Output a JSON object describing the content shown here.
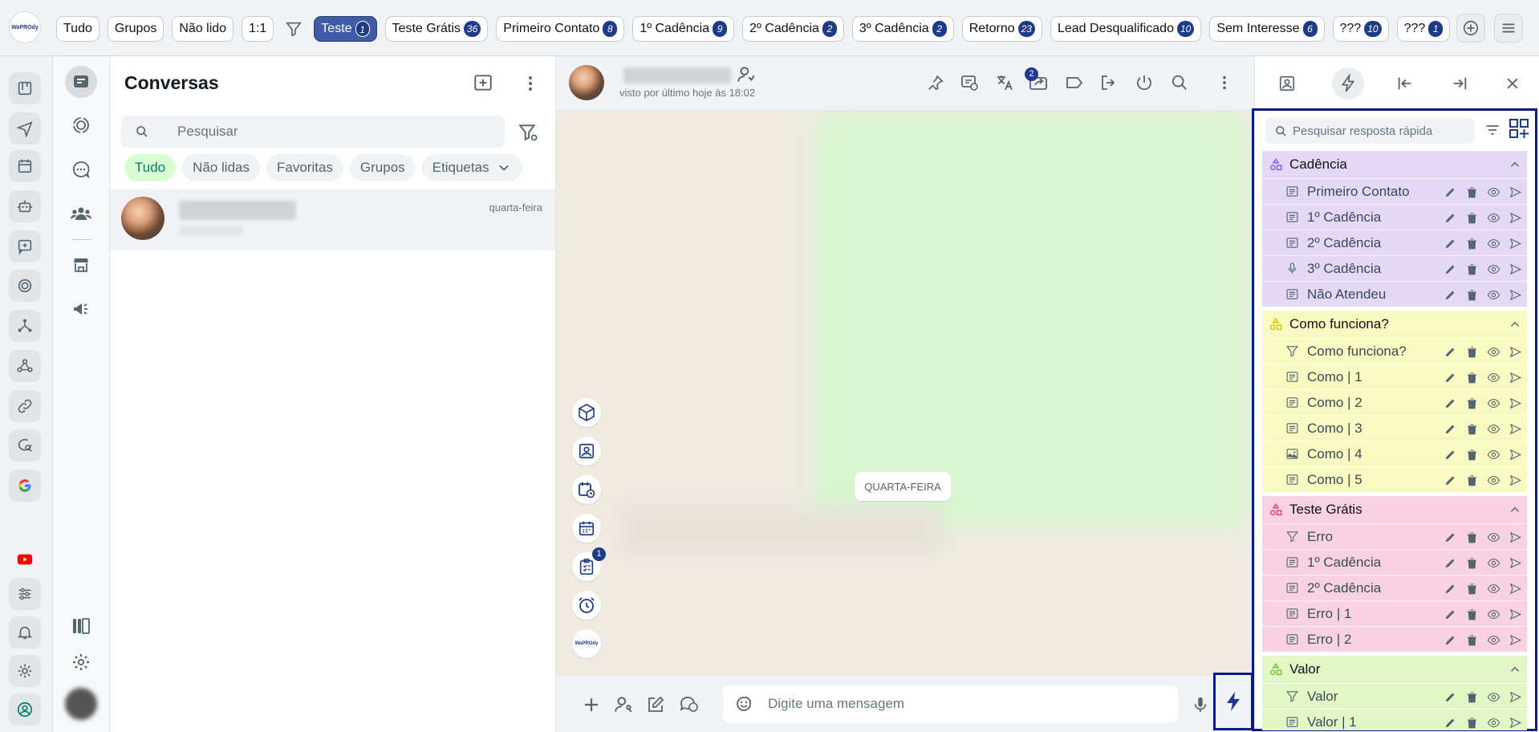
{
  "colors": {
    "accent": "#0b1a8a",
    "badge": "#1e3a8a",
    "whatsapp_green": "#008069"
  },
  "app": {
    "logo_text": "WaPROdy"
  },
  "tagbar": {
    "tags": [
      {
        "label": "Tudo",
        "count": ""
      },
      {
        "label": "Grupos",
        "count": ""
      },
      {
        "label": "Não lido",
        "count": ""
      },
      {
        "label": "1:1",
        "count": ""
      }
    ],
    "filter_icon": "filter-icon",
    "labels": [
      {
        "label": "Teste",
        "count": "1",
        "active": true
      },
      {
        "label": "Teste Grátis",
        "count": "36"
      },
      {
        "label": "Primeiro Contato",
        "count": "8"
      },
      {
        "label": "1º Cadência",
        "count": "9"
      },
      {
        "label": "2º Cadência",
        "count": "2"
      },
      {
        "label": "3º Cadência",
        "count": "2"
      },
      {
        "label": "Retorno",
        "count": "23"
      },
      {
        "label": "Lead Desqualificado",
        "count": "10"
      },
      {
        "label": "Sem Interesse",
        "count": "6"
      },
      {
        "label": "???",
        "count": "10"
      },
      {
        "label": "???",
        "count": "1"
      }
    ]
  },
  "chatlist": {
    "title": "Conversas",
    "search_placeholder": "Pesquisar",
    "chips": [
      "Tudo",
      "Não lidas",
      "Favoritas",
      "Grupos",
      "Etiquetas"
    ],
    "chats": [
      {
        "time": "quarta-feira"
      }
    ]
  },
  "conversation": {
    "status": "visto por último hoje às 18:02",
    "forward_badge": "2",
    "day_label": "QUARTA-FEIRA",
    "tasks_badge": "1",
    "mini_logo": "WaPROdy",
    "composer_placeholder": "Digite uma mensagem"
  },
  "quick_replies": {
    "search_placeholder": "Pesquisar resposta rápida",
    "groups": [
      {
        "name": "Cadência",
        "color": "#e4d8f7",
        "icon_color": "#8b5cf6",
        "items": [
          {
            "label": "Primeiro Contato",
            "type": "text"
          },
          {
            "label": "1º Cadência",
            "type": "text"
          },
          {
            "label": "2º Cadência",
            "type": "text"
          },
          {
            "label": "3º Cadência",
            "type": "audio"
          },
          {
            "label": "Não Atendeu",
            "type": "text"
          }
        ]
      },
      {
        "name": "Como funciona?",
        "color": "#f9f9c2",
        "icon_color": "#d4c800",
        "items": [
          {
            "label": "Como funciona?",
            "type": "funnel"
          },
          {
            "label": "Como | 1",
            "type": "text"
          },
          {
            "label": "Como | 2",
            "type": "text"
          },
          {
            "label": "Como | 3",
            "type": "text"
          },
          {
            "label": "Como | 4",
            "type": "image"
          },
          {
            "label": "Como | 5",
            "type": "text"
          }
        ]
      },
      {
        "name": "Teste Grátis",
        "color": "#f9d2e1",
        "icon_color": "#e0457b",
        "items": [
          {
            "label": "Erro",
            "type": "funnel"
          },
          {
            "label": "1º Cadência",
            "type": "text"
          },
          {
            "label": "2º Cadência",
            "type": "text"
          },
          {
            "label": "Erro | 1",
            "type": "text"
          },
          {
            "label": "Erro | 2",
            "type": "text"
          }
        ]
      },
      {
        "name": "Valor",
        "color": "#e3f6c5",
        "icon_color": "#7cc23a",
        "items": [
          {
            "label": "Valor",
            "type": "funnel"
          },
          {
            "label": "Valor | 1",
            "type": "text"
          }
        ]
      }
    ]
  }
}
